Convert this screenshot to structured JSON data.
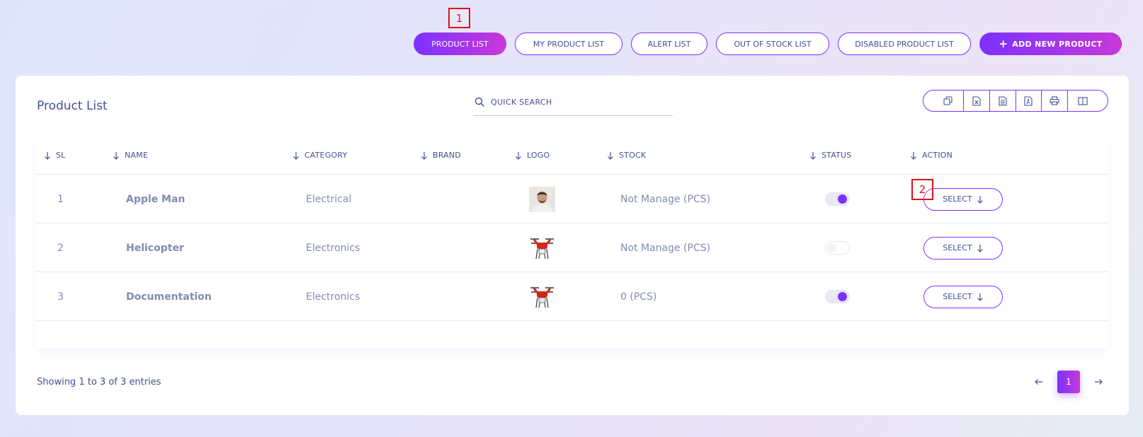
{
  "annotations": [
    "1",
    "2"
  ],
  "tabs": [
    {
      "label": "PRODUCT LIST",
      "active": true
    },
    {
      "label": "MY PRODUCT LIST",
      "active": false
    },
    {
      "label": "ALERT LIST",
      "active": false
    },
    {
      "label": "OUT OF STOCK LIST",
      "active": false
    },
    {
      "label": "DISABLED PRODUCT LIST",
      "active": false
    }
  ],
  "add_button": {
    "icon": "plus-icon",
    "label": "ADD NEW PRODUCT"
  },
  "card": {
    "title": "Product List",
    "search_placeholder": "QUICK SEARCH",
    "export_buttons": [
      "copy-icon",
      "excel-icon",
      "csv-icon",
      "pdf-icon",
      "print-icon",
      "columns-icon"
    ]
  },
  "table": {
    "columns": [
      "SL",
      "NAME",
      "CATEGORY",
      "BRAND",
      "LOGO",
      "STOCK",
      "STATUS",
      "ACTION"
    ],
    "rows": [
      {
        "sl": "1",
        "name": "Apple Man",
        "category": "Electrical",
        "brand": "",
        "logo": "person-photo",
        "stock": "Not Manage (PCS)",
        "status_on": true,
        "action": "SELECT"
      },
      {
        "sl": "2",
        "name": "Helicopter",
        "category": "Electronics",
        "brand": "",
        "logo": "drone-photo",
        "stock": "Not Manage (PCS)",
        "status_on": false,
        "action": "SELECT"
      },
      {
        "sl": "3",
        "name": "Documentation",
        "category": "Electronics",
        "brand": "",
        "logo": "drone-photo",
        "stock": "0 (PCS)",
        "status_on": true,
        "action": "SELECT"
      }
    ]
  },
  "footer": {
    "showing": "Showing 1 to 3 of 3 entries",
    "current_page": "1"
  },
  "colors": {
    "accent": "#7c32ff",
    "accent_end": "#c738d8",
    "text": "#415094",
    "muted": "#828bb2",
    "annotation": "#e2101a"
  }
}
